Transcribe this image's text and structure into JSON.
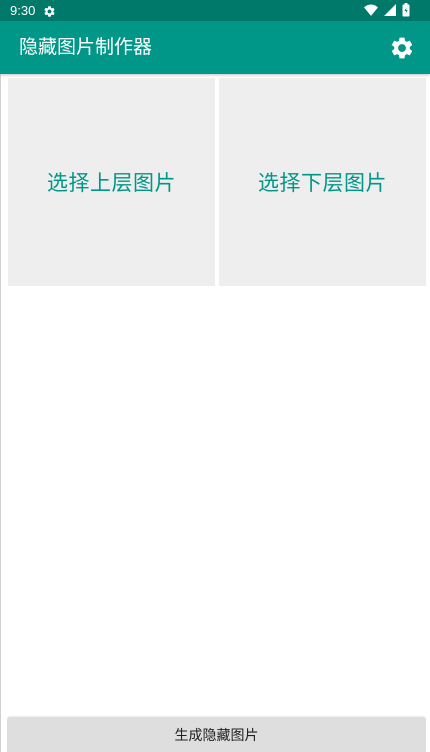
{
  "status_bar": {
    "time": "9:30",
    "icons": [
      "settings-icon",
      "wifi-icon",
      "cell-signal-icon",
      "battery-icon"
    ],
    "color": "#00796b"
  },
  "app_bar": {
    "title": "隐藏图片制作器",
    "action_icon": "gear-icon",
    "color": "#009688"
  },
  "pickers": {
    "upper_label": "选择上层图片",
    "lower_label": "选择下层图片",
    "background": "#eeeeee",
    "text_color": "#009688"
  },
  "footer": {
    "generate_label": "生成隐藏图片"
  }
}
